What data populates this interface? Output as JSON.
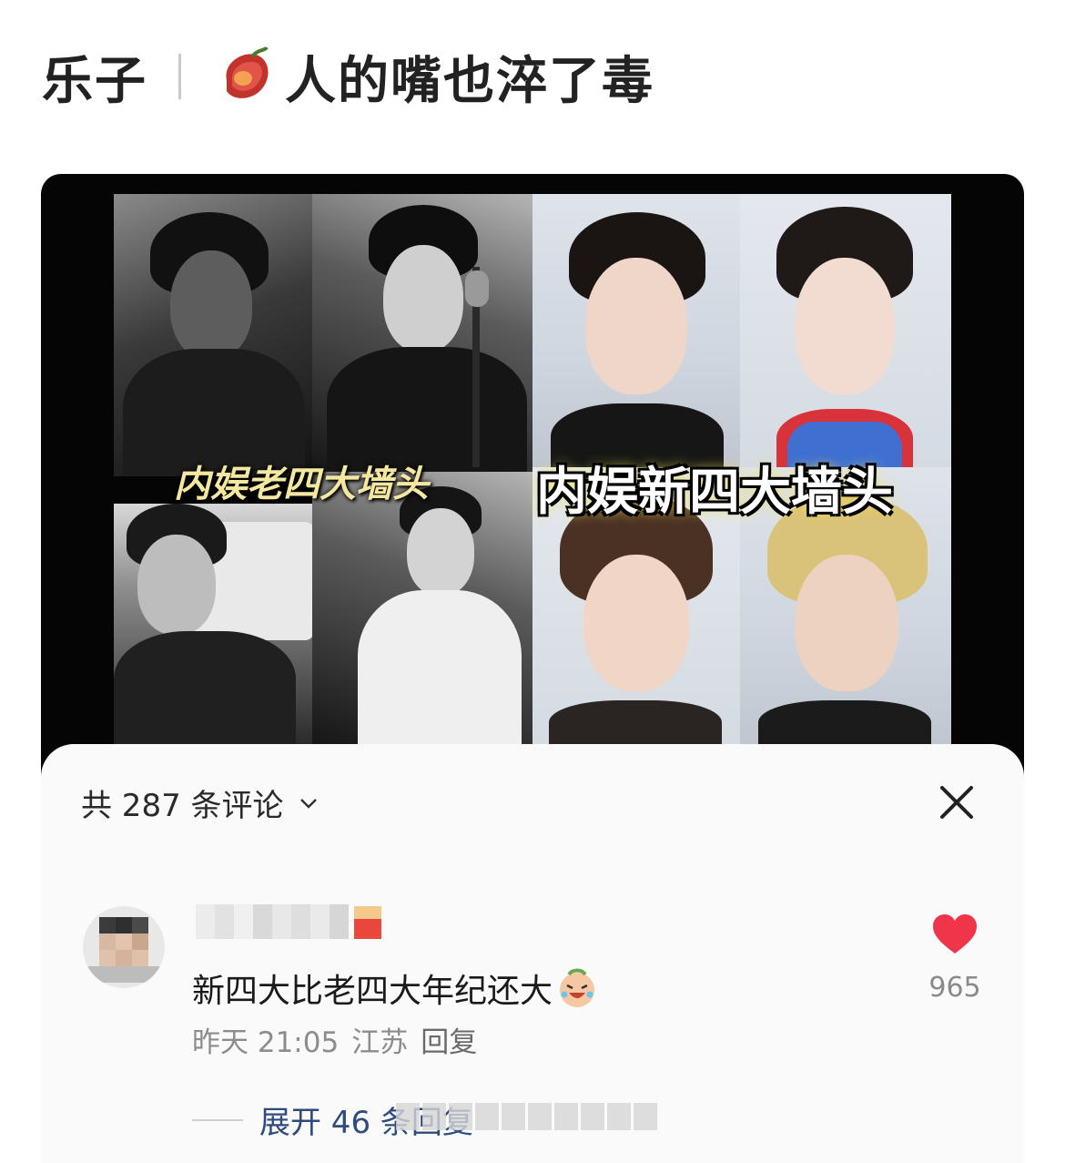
{
  "header": {
    "category": "乐子",
    "title": "人的嘴也淬了毒",
    "icon": "sweet-potato-icon"
  },
  "image": {
    "caption_old": "内娱老四大墙头",
    "caption_new": "内娱新四大墙头"
  },
  "comments": {
    "count_label": "共 287 条评论",
    "close_icon": "close-icon",
    "items": [
      {
        "text": "新四大比老四大年纪还大",
        "emoji": "laughing-crying-emoji",
        "time": "昨天 21:05",
        "location": "江苏",
        "reply_label": "回复",
        "likes": "965",
        "expand_label": "展开 46 条回复"
      }
    ]
  },
  "colors": {
    "like_red": "#f0354a",
    "link_blue": "#2f4b7c",
    "sheet_bg": "#fafafa"
  }
}
